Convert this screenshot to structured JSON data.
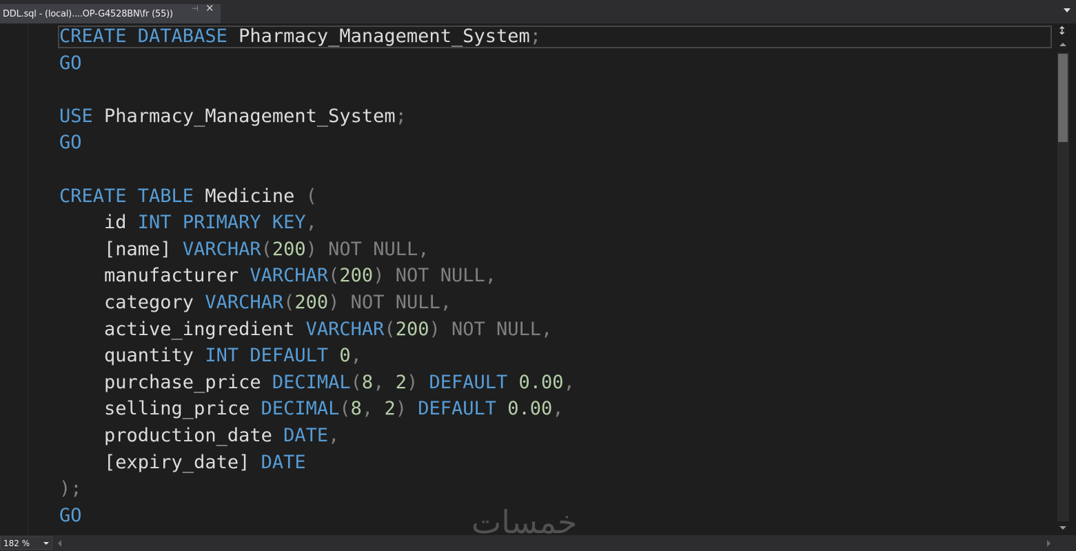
{
  "tab": {
    "title": "DDL.sql - (local)....OP-G4528BN\\fr (55))",
    "pin_icon": "pin-icon",
    "close_icon": "close-icon"
  },
  "editor": {
    "lines": [
      [
        [
          "kw",
          "CREATE DATABASE "
        ],
        [
          "id",
          "Pharmacy_Management_System"
        ],
        [
          "gr",
          ";"
        ]
      ],
      [
        [
          "kw",
          "GO"
        ]
      ],
      [],
      [
        [
          "kw",
          "USE "
        ],
        [
          "id",
          "Pharmacy_Management_System"
        ],
        [
          "gr",
          ";"
        ]
      ],
      [
        [
          "kw",
          "GO"
        ]
      ],
      [],
      [
        [
          "kw",
          "CREATE TABLE "
        ],
        [
          "id",
          "Medicine "
        ],
        [
          "gr",
          "("
        ]
      ],
      [
        [
          "id",
          "    id "
        ],
        [
          "kw",
          "INT PRIMARY KEY"
        ],
        [
          "gr",
          ","
        ]
      ],
      [
        [
          "id",
          "    [name] "
        ],
        [
          "kw",
          "VARCHAR"
        ],
        [
          "gr",
          "("
        ],
        [
          "nm",
          "200"
        ],
        [
          "gr",
          ") NOT NULL,"
        ]
      ],
      [
        [
          "id",
          "    manufacturer "
        ],
        [
          "kw",
          "VARCHAR"
        ],
        [
          "gr",
          "("
        ],
        [
          "nm",
          "200"
        ],
        [
          "gr",
          ") NOT NULL,"
        ]
      ],
      [
        [
          "id",
          "    category "
        ],
        [
          "kw",
          "VARCHAR"
        ],
        [
          "gr",
          "("
        ],
        [
          "nm",
          "200"
        ],
        [
          "gr",
          ") NOT NULL,"
        ]
      ],
      [
        [
          "id",
          "    active_ingredient "
        ],
        [
          "kw",
          "VARCHAR"
        ],
        [
          "gr",
          "("
        ],
        [
          "nm",
          "200"
        ],
        [
          "gr",
          ") NOT NULL,"
        ]
      ],
      [
        [
          "id",
          "    quantity "
        ],
        [
          "kw",
          "INT DEFAULT "
        ],
        [
          "nm",
          "0"
        ],
        [
          "gr",
          ","
        ]
      ],
      [
        [
          "id",
          "    purchase_price "
        ],
        [
          "kw",
          "DECIMAL"
        ],
        [
          "gr",
          "("
        ],
        [
          "nm",
          "8"
        ],
        [
          "gr",
          ", "
        ],
        [
          "nm",
          "2"
        ],
        [
          "gr",
          ") "
        ],
        [
          "kw",
          "DEFAULT "
        ],
        [
          "nm",
          "0.00"
        ],
        [
          "gr",
          ","
        ]
      ],
      [
        [
          "id",
          "    selling_price "
        ],
        [
          "kw",
          "DECIMAL"
        ],
        [
          "gr",
          "("
        ],
        [
          "nm",
          "8"
        ],
        [
          "gr",
          ", "
        ],
        [
          "nm",
          "2"
        ],
        [
          "gr",
          ") "
        ],
        [
          "kw",
          "DEFAULT "
        ],
        [
          "nm",
          "0.00"
        ],
        [
          "gr",
          ","
        ]
      ],
      [
        [
          "id",
          "    production_date "
        ],
        [
          "kw",
          "DATE"
        ],
        [
          "gr",
          ","
        ]
      ],
      [
        [
          "id",
          "    [expiry_date] "
        ],
        [
          "kw",
          "DATE"
        ]
      ],
      [
        [
          "gr",
          ");"
        ]
      ],
      [
        [
          "kw",
          "GO"
        ]
      ]
    ]
  },
  "status": {
    "zoom": "182 %"
  },
  "watermark": {
    "text": "خمسات"
  },
  "colors": {
    "keyword": "#569cd6",
    "gray": "#808080",
    "number": "#b5cea8",
    "identifier": "#dcdcdc",
    "background": "#1e1e1e"
  }
}
